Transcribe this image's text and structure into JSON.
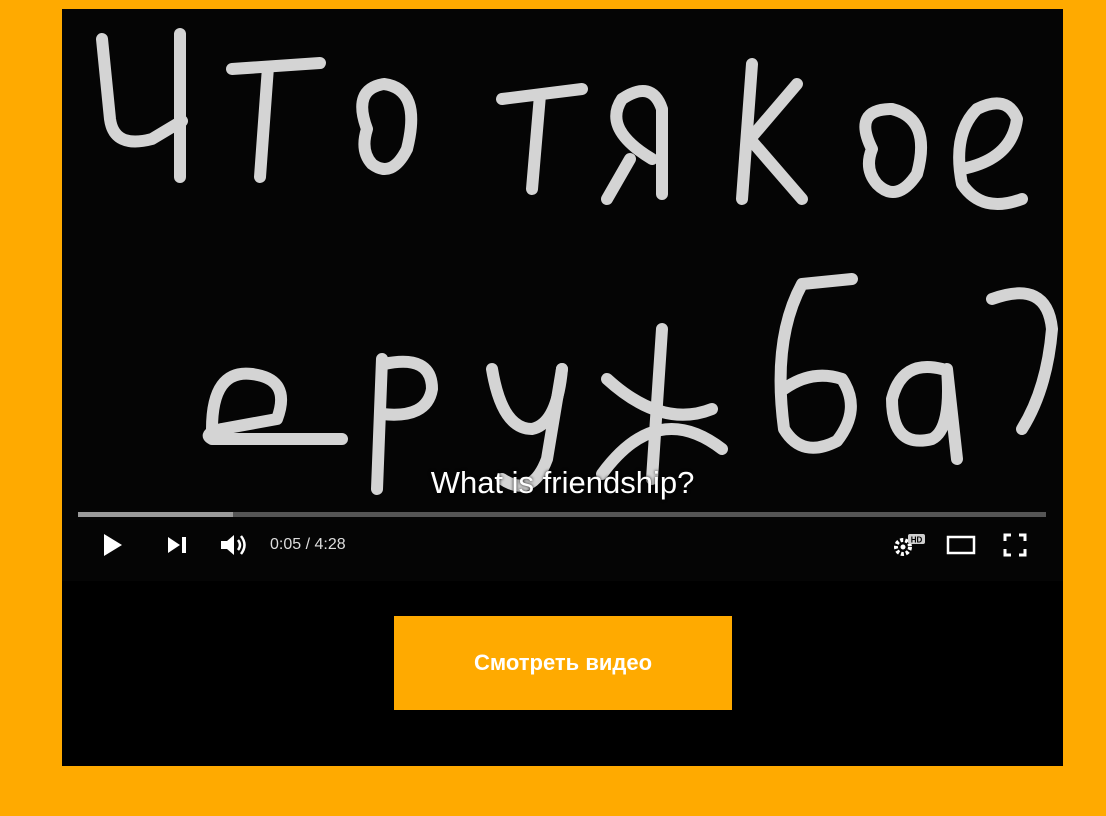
{
  "video": {
    "subtitle": "What is friendship?",
    "elapsed": "0:05",
    "duration": "4:28",
    "time_display": "0:05 / 4:28",
    "progress_fraction": 0.16,
    "hd_badge": "HD"
  },
  "controls": {
    "icons": [
      "play-icon",
      "next-icon",
      "volume-icon",
      "settings-icon",
      "theater-mode-icon",
      "fullscreen-icon"
    ]
  },
  "cta": {
    "label": "Смотреть видео"
  },
  "colors": {
    "accent": "#FFAA00",
    "frame": "#000000",
    "button_text": "#FFFFFF"
  }
}
